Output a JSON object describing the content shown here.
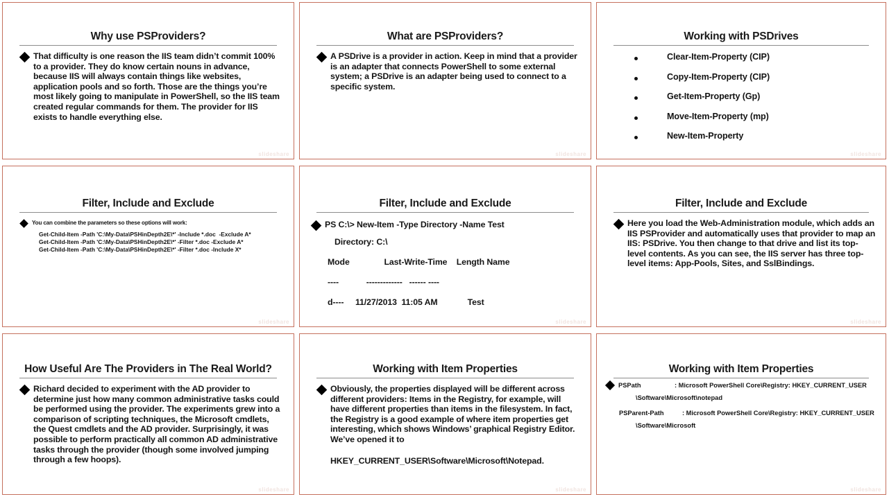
{
  "deck": {
    "border_color": "#c5705d",
    "rule_color": "#8c8c8c",
    "watermark": "slideshare"
  },
  "slides": [
    {
      "id": "why-use-psproviders",
      "title": "Why use PSProviders?",
      "bullet_style": "diamond",
      "body": "That difficulty is one reason the IIS team didn’t commit 100% to a provider. They do know certain nouns in advance, because IIS will always contain things like websites, application pools and so forth. Those are the things you’re most likely going to manipulate in PowerShell, so the IIS team created regular commands for them. The provider for IIS exists to handle everything else."
    },
    {
      "id": "what-are-psproviders",
      "title": "What are PSProviders?",
      "bullet_style": "diamond",
      "body": "A PSDrive is a provider in action. Keep in mind that a provider is an adapter that connects PowerShell to some external system; a PSDrive is an adapter being used to connect to a specific system."
    },
    {
      "id": "working-with-psdrives",
      "title": "Working with PSDrives",
      "bullet_style": "dot",
      "items": [
        "Clear-Item-Property (CIP)",
        "Copy-Item-Property (CIP)",
        "Get-Item-Property (Gp)",
        "Move-Item-Property (mp)",
        "New-Item-Property"
      ]
    },
    {
      "id": "filter-include-exclude-1",
      "title": "Filter, Include and Exclude",
      "bullet_style": "diamond",
      "body": "You can combine the parameters so these options will work:",
      "code": "Get-Child-Item -Path 'C:\\My-Data\\PSHinDepth2E\\*' -Include *.doc  -Exclude A*\nGet-Child-Item -Path 'C:\\My-Data\\PSHinDepth2E\\*' -Filter *.doc -Exclude A*\nGet-Child-Item -Path 'C:\\My-Data\\PSHinDepth2E\\*' -Filter *.doc -Include X*"
    },
    {
      "id": "filter-include-exclude-2",
      "title": "Filter, Include and Exclude",
      "bullet_style": "diamond",
      "command": "PS C:\\> New-Item -Type Directory -Name Test",
      "console_lines": [
        "   Directory: C:\\",
        "Mode               Last-Write-Time    Length Name",
        "----            -------------   ------ ----",
        "d----     11/27/2013  11:05 AM             Test"
      ]
    },
    {
      "id": "filter-include-exclude-3",
      "title": "Filter, Include and Exclude",
      "bullet_style": "diamond",
      "body": "Here you load the Web-Administration module, which adds an IIS PSProvider and automatically uses that provider to map an IIS: PSDrive. You then change to that drive and list its top-level contents. As you can see, the IIS server has three top-level items: App-Pools, Sites, and SslBindings."
    },
    {
      "id": "how-useful-providers-real-world",
      "title": "How Useful Are The Providers in The Real World?",
      "bullet_style": "diamond",
      "body": "Richard decided to experiment with the AD provider to determine just how many common administrative tasks could be performed using the provider. The experiments grew into a comparison of scripting techniques, the Microsoft cmdlets, the Quest cmdlets and the AD provider. Surprisingly, it was possible to perform practically all common AD administrative tasks through the provider (though some involved jumping through a few hoops)."
    },
    {
      "id": "working-with-item-properties-1",
      "title": "Working with Item Properties",
      "bullet_style": "diamond",
      "body": "Obviously, the properties displayed will be different across different providers: Items in the Registry, for example, will have different properties than items in the filesystem. In fact, the Registry is a good example of where item properties get interesting, which shows Windows’ graphical Registry Editor. We’ve opened it to",
      "footer": "HKEY_CURRENT_USER\\Software\\Microsoft\\Notepad."
    },
    {
      "id": "working-with-item-properties-2",
      "title": "Working with Item Properties",
      "bullet_style": "diamond",
      "properties": [
        {
          "name": "PSPath",
          "value": ": Microsoft PowerShell Core\\Registry: HKEY_CURRENT_USER",
          "continuation": "\\Software\\Microsoft\\notepad"
        },
        {
          "name": "PSParent-Path",
          "value": ": Microsoft PowerShell Core\\Registry: HKEY_CURRENT_USER",
          "continuation": "\\Software\\Microsoft"
        }
      ]
    }
  ]
}
